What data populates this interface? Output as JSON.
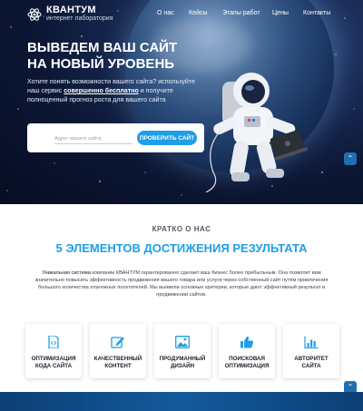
{
  "header": {
    "logo_title": "КВАНТУМ",
    "logo_subtitle": "интернет лаборатория",
    "nav": [
      "О нас",
      "Кейсы",
      "Этапы работ",
      "Цены",
      "Контакты"
    ]
  },
  "hero": {
    "title_line1": "ВЫВЕДЕМ ВАШ САЙТ",
    "title_line2": "НА НОВЫЙ УРОВЕНЬ",
    "text_before": "Хотите понять возможности вашего сайта? используйте наш сервис ",
    "text_bold": "совершенно бесплатно",
    "text_after": " и получите полноценный прогноз роста для вашего сайта",
    "input_placeholder": "Адрес вашего сайта",
    "button_label": "ПРОВЕРИТЬ САЙТ"
  },
  "about": {
    "kicker": "КРАТКО О НАС",
    "title": "5 ЭЛЕМЕНТОВ ДОСТИЖЕНИЯ РЕЗУЛЬТАТА",
    "text_bold": "Уникальная система",
    "text_rest": " компании КВАНТУМ гарантированно сделает ваш бизнес более прибыльным. Она позволит вам значительно повысить эффективность продвижения вашего товара или услуги через собственный сайт путём привлечения большого количества платежных посетителей. Мы выявили основные критерии, которые дают эффективный результат в продвижении сайтов."
  },
  "cards": [
    {
      "line1": "ОПТИМИЗАЦИЯ",
      "line2": "КОДА САЙТА",
      "icon": "code-file-icon"
    },
    {
      "line1": "КАЧЕСТВЕННЫЙ",
      "line2": "КОНТЕНТ",
      "icon": "edit-icon"
    },
    {
      "line1": "ПРОДУМАННЫЙ",
      "line2": "ДИЗАЙН",
      "icon": "image-icon"
    },
    {
      "line1": "ПОИСКОВАЯ",
      "line2": "ОПТИМИЗАЦИЯ",
      "icon": "thumbs-up-icon"
    },
    {
      "line1": "АВТОРИТЕТ",
      "line2": "САЙТА",
      "icon": "bar-chart-icon"
    }
  ],
  "colors": {
    "accent": "#1f9ee8",
    "hero_dark": "#0c1735",
    "strip": "#135a9c"
  }
}
